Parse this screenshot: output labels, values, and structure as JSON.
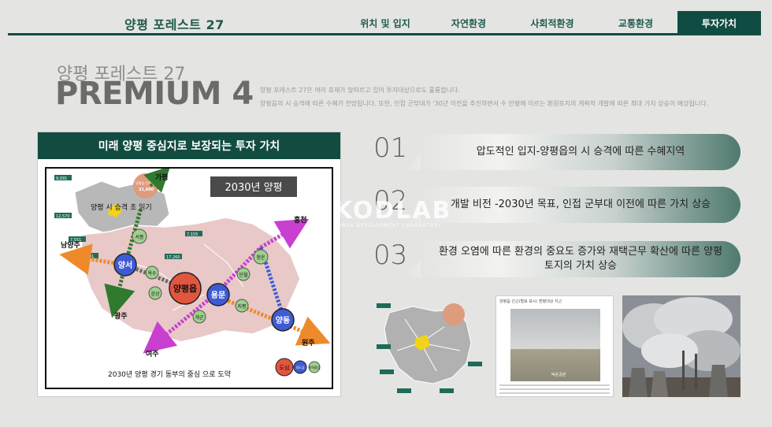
{
  "header": {
    "brand": "양평 포레스트 27",
    "nav": [
      {
        "label": "위치 및 입지",
        "active": false
      },
      {
        "label": "자연환경",
        "active": false
      },
      {
        "label": "사회적환경",
        "active": false
      },
      {
        "label": "교통환경",
        "active": false
      },
      {
        "label": "투자가치",
        "active": true
      }
    ]
  },
  "hero": {
    "subtitle": "양평 포레스트 27",
    "title": "PREMIUM 4",
    "desc1": "양평 포레스트 27은 여러 호재가 맞따르고 있어 투자대상으로도 훌륭합니다.",
    "desc2": "양평읍의 시 승격에 따른 수혜가 전망됩니다. 또한, 인접 군부대가 '30년 이전을 추진하면서 수 만평에 이르는 환원토지의 계획적 개발에 따른 최대 가치 상승이 예상됩니다."
  },
  "panel": {
    "title": "미래 양평 중심지로 보장되는 투자 가치",
    "badge": "2030년 양평",
    "caption": "2030년 양평 경기 동부의 중심 으로 도약",
    "places": {
      "gapyeong": "가평",
      "yangpyeong_city": "양평 시 승격 초 읽기",
      "namyangju": "남양주",
      "gwangju": "광주",
      "yeoju": "여주",
      "hongcheon": "홍천",
      "wonju": "원주"
    },
    "nodes": {
      "yangseo": "양서",
      "yangpyeongeup": "양평읍",
      "yongmun": "용문",
      "yangdong": "양동",
      "seojong": "서종",
      "oksu": "옥수",
      "gangsang": "강상",
      "gaegun": "개군",
      "danwol": "단월",
      "cheongun": "청운",
      "jipyeong": "지평"
    },
    "stats": {
      "s1": "9,091",
      "s2": "12,570",
      "s3": "7,551",
      "s4": "6,701",
      "s5": "7,155",
      "s6": "17,260",
      "pop_label": "양평읍 인구 현황",
      "pop_value": "31,000"
    },
    "legend": {
      "center": "도심",
      "sub": "부도심",
      "local": "지역중심"
    }
  },
  "watermark": {
    "main": "KODLAB",
    "sub": "KOREA DEVELOPMENT LABORATORY"
  },
  "list": [
    {
      "num": "01",
      "text": "압도적인 입지-양평읍의 시 승격에 따른 수혜지역"
    },
    {
      "num": "02",
      "text": "개발 비전 -2030년 목표, 인접 군부대 이전에 따른 가치 상승"
    },
    {
      "num": "03",
      "text": "환경 오염에 따른 환경의 중요도 증가와 재택근무 확산에 따른 양평 토지의 가치 상승"
    }
  ],
  "thumbs": {
    "doc_title": "양평읍 인근(별표 표시) 환평대상 지근",
    "doc_caption": "탁운공원"
  },
  "colors": {
    "brand_green": "#124c41",
    "center_red": "#e2553f",
    "sub_blue": "#3f5bd4",
    "local_green": "#9fcf8e"
  }
}
